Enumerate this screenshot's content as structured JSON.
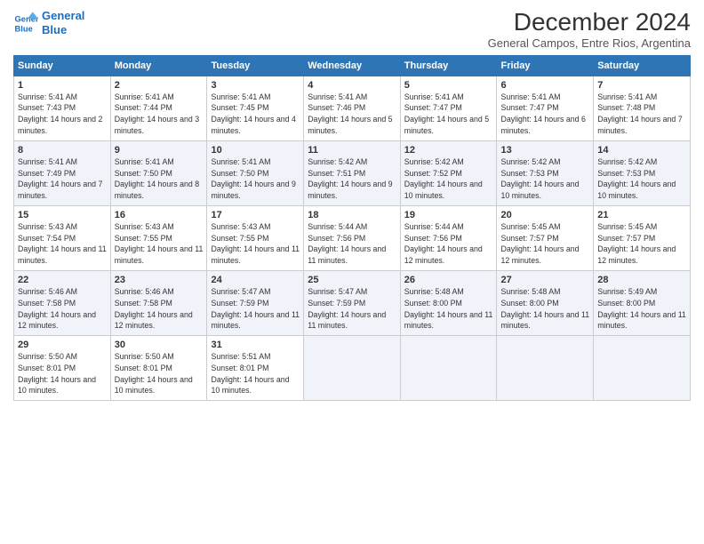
{
  "header": {
    "logo_line1": "General",
    "logo_line2": "Blue",
    "title": "December 2024",
    "subtitle": "General Campos, Entre Rios, Argentina"
  },
  "columns": [
    "Sunday",
    "Monday",
    "Tuesday",
    "Wednesday",
    "Thursday",
    "Friday",
    "Saturday"
  ],
  "weeks": [
    [
      {
        "day": "1",
        "sunrise": "Sunrise: 5:41 AM",
        "sunset": "Sunset: 7:43 PM",
        "daylight": "Daylight: 14 hours and 2 minutes."
      },
      {
        "day": "2",
        "sunrise": "Sunrise: 5:41 AM",
        "sunset": "Sunset: 7:44 PM",
        "daylight": "Daylight: 14 hours and 3 minutes."
      },
      {
        "day": "3",
        "sunrise": "Sunrise: 5:41 AM",
        "sunset": "Sunset: 7:45 PM",
        "daylight": "Daylight: 14 hours and 4 minutes."
      },
      {
        "day": "4",
        "sunrise": "Sunrise: 5:41 AM",
        "sunset": "Sunset: 7:46 PM",
        "daylight": "Daylight: 14 hours and 5 minutes."
      },
      {
        "day": "5",
        "sunrise": "Sunrise: 5:41 AM",
        "sunset": "Sunset: 7:47 PM",
        "daylight": "Daylight: 14 hours and 5 minutes."
      },
      {
        "day": "6",
        "sunrise": "Sunrise: 5:41 AM",
        "sunset": "Sunset: 7:47 PM",
        "daylight": "Daylight: 14 hours and 6 minutes."
      },
      {
        "day": "7",
        "sunrise": "Sunrise: 5:41 AM",
        "sunset": "Sunset: 7:48 PM",
        "daylight": "Daylight: 14 hours and 7 minutes."
      }
    ],
    [
      {
        "day": "8",
        "sunrise": "Sunrise: 5:41 AM",
        "sunset": "Sunset: 7:49 PM",
        "daylight": "Daylight: 14 hours and 7 minutes."
      },
      {
        "day": "9",
        "sunrise": "Sunrise: 5:41 AM",
        "sunset": "Sunset: 7:50 PM",
        "daylight": "Daylight: 14 hours and 8 minutes."
      },
      {
        "day": "10",
        "sunrise": "Sunrise: 5:41 AM",
        "sunset": "Sunset: 7:50 PM",
        "daylight": "Daylight: 14 hours and 9 minutes."
      },
      {
        "day": "11",
        "sunrise": "Sunrise: 5:42 AM",
        "sunset": "Sunset: 7:51 PM",
        "daylight": "Daylight: 14 hours and 9 minutes."
      },
      {
        "day": "12",
        "sunrise": "Sunrise: 5:42 AM",
        "sunset": "Sunset: 7:52 PM",
        "daylight": "Daylight: 14 hours and 10 minutes."
      },
      {
        "day": "13",
        "sunrise": "Sunrise: 5:42 AM",
        "sunset": "Sunset: 7:53 PM",
        "daylight": "Daylight: 14 hours and 10 minutes."
      },
      {
        "day": "14",
        "sunrise": "Sunrise: 5:42 AM",
        "sunset": "Sunset: 7:53 PM",
        "daylight": "Daylight: 14 hours and 10 minutes."
      }
    ],
    [
      {
        "day": "15",
        "sunrise": "Sunrise: 5:43 AM",
        "sunset": "Sunset: 7:54 PM",
        "daylight": "Daylight: 14 hours and 11 minutes."
      },
      {
        "day": "16",
        "sunrise": "Sunrise: 5:43 AM",
        "sunset": "Sunset: 7:55 PM",
        "daylight": "Daylight: 14 hours and 11 minutes."
      },
      {
        "day": "17",
        "sunrise": "Sunrise: 5:43 AM",
        "sunset": "Sunset: 7:55 PM",
        "daylight": "Daylight: 14 hours and 11 minutes."
      },
      {
        "day": "18",
        "sunrise": "Sunrise: 5:44 AM",
        "sunset": "Sunset: 7:56 PM",
        "daylight": "Daylight: 14 hours and 11 minutes."
      },
      {
        "day": "19",
        "sunrise": "Sunrise: 5:44 AM",
        "sunset": "Sunset: 7:56 PM",
        "daylight": "Daylight: 14 hours and 12 minutes."
      },
      {
        "day": "20",
        "sunrise": "Sunrise: 5:45 AM",
        "sunset": "Sunset: 7:57 PM",
        "daylight": "Daylight: 14 hours and 12 minutes."
      },
      {
        "day": "21",
        "sunrise": "Sunrise: 5:45 AM",
        "sunset": "Sunset: 7:57 PM",
        "daylight": "Daylight: 14 hours and 12 minutes."
      }
    ],
    [
      {
        "day": "22",
        "sunrise": "Sunrise: 5:46 AM",
        "sunset": "Sunset: 7:58 PM",
        "daylight": "Daylight: 14 hours and 12 minutes."
      },
      {
        "day": "23",
        "sunrise": "Sunrise: 5:46 AM",
        "sunset": "Sunset: 7:58 PM",
        "daylight": "Daylight: 14 hours and 12 minutes."
      },
      {
        "day": "24",
        "sunrise": "Sunrise: 5:47 AM",
        "sunset": "Sunset: 7:59 PM",
        "daylight": "Daylight: 14 hours and 11 minutes."
      },
      {
        "day": "25",
        "sunrise": "Sunrise: 5:47 AM",
        "sunset": "Sunset: 7:59 PM",
        "daylight": "Daylight: 14 hours and 11 minutes."
      },
      {
        "day": "26",
        "sunrise": "Sunrise: 5:48 AM",
        "sunset": "Sunset: 8:00 PM",
        "daylight": "Daylight: 14 hours and 11 minutes."
      },
      {
        "day": "27",
        "sunrise": "Sunrise: 5:48 AM",
        "sunset": "Sunset: 8:00 PM",
        "daylight": "Daylight: 14 hours and 11 minutes."
      },
      {
        "day": "28",
        "sunrise": "Sunrise: 5:49 AM",
        "sunset": "Sunset: 8:00 PM",
        "daylight": "Daylight: 14 hours and 11 minutes."
      }
    ],
    [
      {
        "day": "29",
        "sunrise": "Sunrise: 5:50 AM",
        "sunset": "Sunset: 8:01 PM",
        "daylight": "Daylight: 14 hours and 10 minutes."
      },
      {
        "day": "30",
        "sunrise": "Sunrise: 5:50 AM",
        "sunset": "Sunset: 8:01 PM",
        "daylight": "Daylight: 14 hours and 10 minutes."
      },
      {
        "day": "31",
        "sunrise": "Sunrise: 5:51 AM",
        "sunset": "Sunset: 8:01 PM",
        "daylight": "Daylight: 14 hours and 10 minutes."
      },
      null,
      null,
      null,
      null
    ]
  ]
}
